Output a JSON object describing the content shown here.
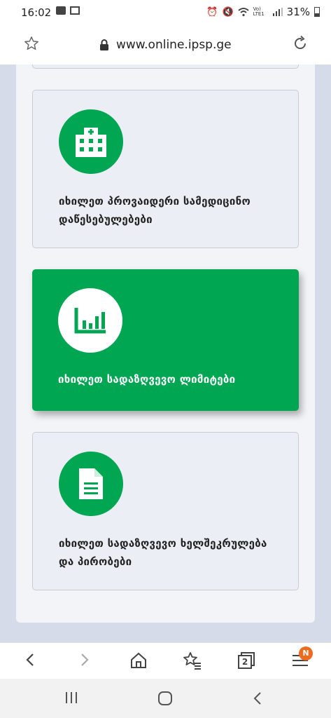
{
  "status": {
    "time": "16:02",
    "battery_pct": "31%",
    "signal_label": "Vo) LTE1"
  },
  "browser": {
    "url": "www.online.ipsp.ge",
    "tab_count": "2",
    "menu_badge": "N"
  },
  "cards": [
    {
      "label": "იხილეთ პროვაიდერი სამედიცინო დაწესებულებები",
      "icon": "hospital-icon"
    },
    {
      "label": "იხილეთ სადაზღვევო ლიმიტები",
      "icon": "bar-chart-icon"
    },
    {
      "label": "იხილეთ სადაზღვევო ხელშეკრულება და პირობები",
      "icon": "document-icon"
    }
  ],
  "colors": {
    "accent": "#00a651",
    "badge": "#ee6a1e",
    "background": "#d5dbe8"
  }
}
